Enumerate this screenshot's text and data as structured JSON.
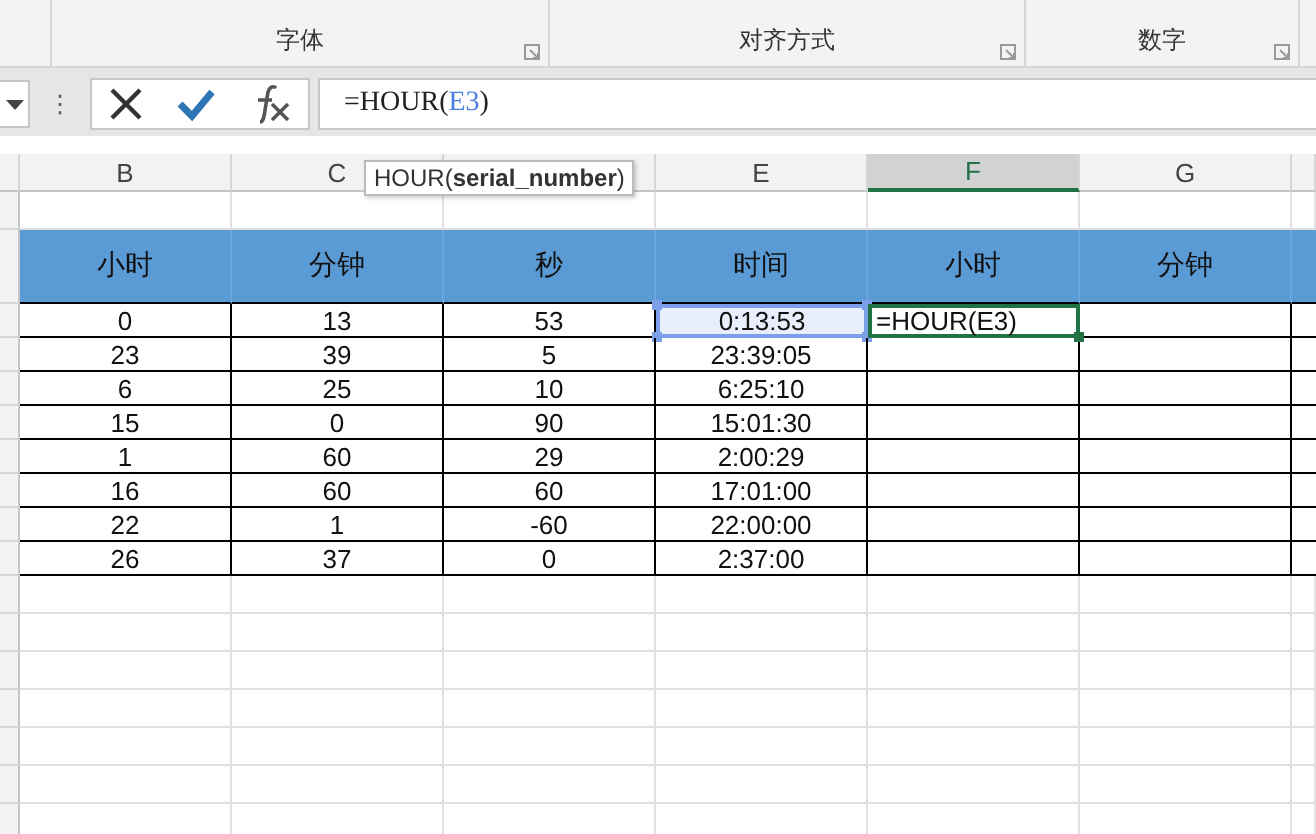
{
  "ribbon": {
    "groups": [
      {
        "label": "字体"
      },
      {
        "label": "对齐方式"
      },
      {
        "label": "数字"
      }
    ]
  },
  "formula_bar": {
    "more": "⋮",
    "parts": [
      {
        "kind": "text",
        "text": "=HOUR("
      },
      {
        "kind": "ref",
        "text": "E3"
      },
      {
        "kind": "text",
        "text": ")"
      }
    ]
  },
  "tooltip": "HOUR(**serial_number**)",
  "columns": [
    {
      "label": "B",
      "selected": false
    },
    {
      "label": "C",
      "selected": false
    },
    {
      "selected": false
    },
    {
      "label": "E",
      "selected": false
    },
    {
      "label": "F",
      "selected": true
    },
    {
      "label": "G",
      "selected": false
    }
  ],
  "table": {
    "headers": [
      "小时",
      "分钟",
      "秒",
      "时间",
      "小时",
      "分钟"
    ],
    "rows": [
      {
        "cells": [
          {
            "text": "0",
            "referenced": false,
            "editing": false
          },
          {
            "text": "13",
            "referenced": false,
            "editing": false
          },
          {
            "text": "53",
            "referenced": false,
            "editing": false
          },
          {
            "text": "0:13:53",
            "referenced": true,
            "editing": false
          },
          {
            "text": "=HOUR(E3)",
            "referenced": false,
            "editing": true
          },
          {
            "referenced": false,
            "editing": false
          }
        ]
      },
      {
        "cells": [
          {
            "text": "23",
            "referenced": false,
            "editing": false
          },
          {
            "text": "39",
            "referenced": false,
            "editing": false
          },
          {
            "text": "5",
            "referenced": false,
            "editing": false
          },
          {
            "text": "23:39:05",
            "referenced": false,
            "editing": false
          },
          {
            "referenced": false,
            "editing": false
          },
          {
            "referenced": false,
            "editing": false
          }
        ]
      },
      {
        "cells": [
          {
            "text": "6",
            "referenced": false,
            "editing": false
          },
          {
            "text": "25",
            "referenced": false,
            "editing": false
          },
          {
            "text": "10",
            "referenced": false,
            "editing": false
          },
          {
            "text": "6:25:10",
            "referenced": false,
            "editing": false
          },
          {
            "referenced": false,
            "editing": false
          },
          {
            "referenced": false,
            "editing": false
          }
        ]
      },
      {
        "cells": [
          {
            "text": "15",
            "referenced": false,
            "editing": false
          },
          {
            "text": "0",
            "referenced": false,
            "editing": false
          },
          {
            "text": "90",
            "referenced": false,
            "editing": false
          },
          {
            "text": "15:01:30",
            "referenced": false,
            "editing": false
          },
          {
            "referenced": false,
            "editing": false
          },
          {
            "referenced": false,
            "editing": false
          }
        ]
      },
      {
        "cells": [
          {
            "text": "1",
            "referenced": false,
            "editing": false
          },
          {
            "text": "60",
            "referenced": false,
            "editing": false
          },
          {
            "text": "29",
            "referenced": false,
            "editing": false
          },
          {
            "text": "2:00:29",
            "referenced": false,
            "editing": false
          },
          {
            "referenced": false,
            "editing": false
          },
          {
            "referenced": false,
            "editing": false
          }
        ]
      },
      {
        "cells": [
          {
            "text": "16",
            "referenced": false,
            "editing": false
          },
          {
            "text": "60",
            "referenced": false,
            "editing": false
          },
          {
            "text": "60",
            "referenced": false,
            "editing": false
          },
          {
            "text": "17:01:00",
            "referenced": false,
            "editing": false
          },
          {
            "referenced": false,
            "editing": false
          },
          {
            "referenced": false,
            "editing": false
          }
        ]
      },
      {
        "cells": [
          {
            "text": "22",
            "referenced": false,
            "editing": false
          },
          {
            "text": "1",
            "referenced": false,
            "editing": false
          },
          {
            "text": "-60",
            "referenced": false,
            "editing": false
          },
          {
            "text": "22:00:00",
            "referenced": false,
            "editing": false
          },
          {
            "referenced": false,
            "editing": false
          },
          {
            "referenced": false,
            "editing": false
          }
        ]
      },
      {
        "cells": [
          {
            "text": "26",
            "referenced": false,
            "editing": false
          },
          {
            "text": "37",
            "referenced": false,
            "editing": false
          },
          {
            "text": "0",
            "referenced": false,
            "editing": false
          },
          {
            "text": "2:37:00",
            "referenced": false,
            "editing": false
          },
          {
            "referenced": false,
            "editing": false
          },
          {
            "referenced": false,
            "editing": false
          }
        ]
      }
    ]
  }
}
